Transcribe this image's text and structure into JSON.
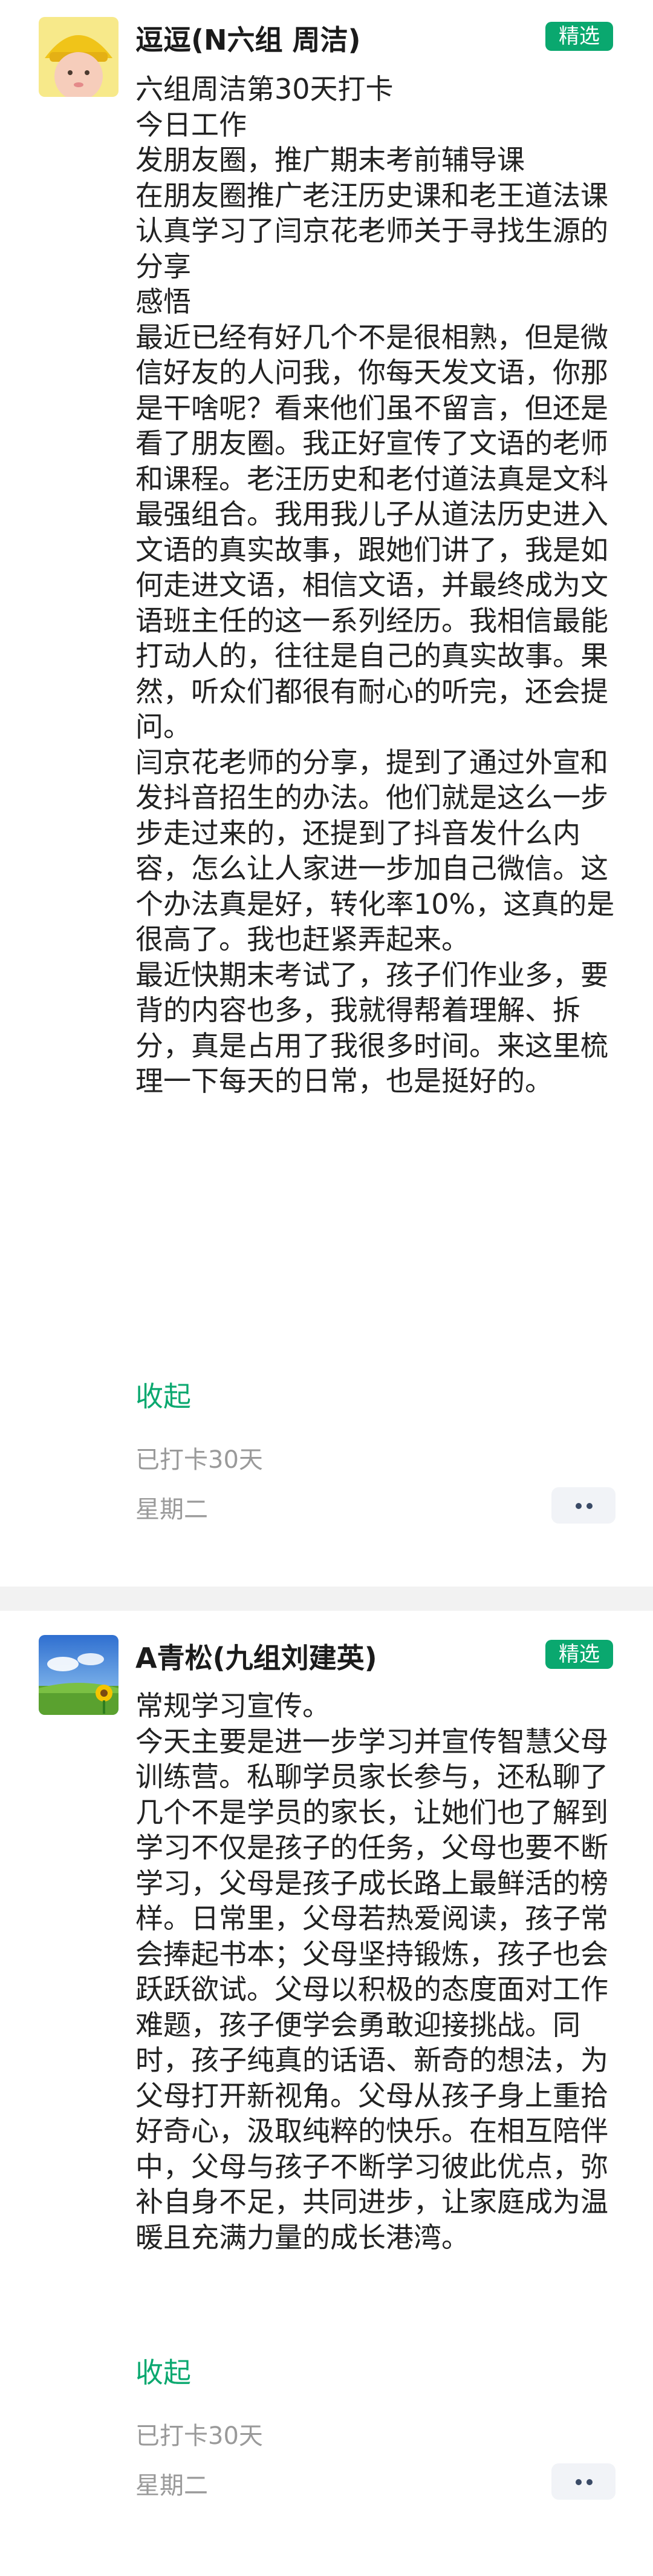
{
  "posts": [
    {
      "author": "逗逗(N六组 周洁)",
      "badge": "精选",
      "avatar_icon": "yellow-hat-child-avatar",
      "paragraphs": [
        "六组周洁第30天打卡",
        "今日工作",
        "发朋友圈，推广期末考前辅导课",
        "在朋友圈推广老汪历史课和老王道法课",
        "认真学习了闫京花老师关于寻找生源的分享",
        "感悟",
        "最近已经有好几个不是很相熟，但是微信好友的人问我，你每天发文语，你那是干啥呢？看来他们虽不留言，但还是看了朋友圈。我正好宣传了文语的老师和课程。老汪历史和老付道法真是文科最强组合。我用我儿子从道法历史进入文语的真实故事，跟她们讲了，我是如何走进文语，相信文语，并最终成为文语班主任的这一系列经历。我相信最能打动人的，往往是自己的真实故事。果然，听众们都很有耐心的听完，还会提问。",
        "闫京花老师的分享，提到了通过外宣和发抖音招生的办法。他们就是这么一步步走过来的，还提到了抖音发什么内容，怎么让人家进一步加自己微信。这个办法真是好，转化率10%，这真的是很高了。我也赶紧弄起来。",
        "最近快期末考试了，孩子们作业多，要背的内容也多，我就得帮着理解、拆分，真是占用了我很多时间。来这里梳理一下每天的日常，也是挺好的。"
      ],
      "collapse_label": "收起",
      "checkin_text": "已打卡30天",
      "date_text": "星期二"
    },
    {
      "author": "A青松(九组刘建英)",
      "badge": "精选",
      "avatar_icon": "sky-meadow-sunflower-avatar",
      "paragraphs": [
        "常规学习宣传。",
        "今天主要是进一步学习并宣传智慧父母训练营。私聊学员家长参与，还私聊了几个不是学员的家长，让她们也了解到学习不仅是孩子的任务，父母也要不断学习，父母是孩子成长路上最鲜活的榜样。日常里，父母若热爱阅读，孩子常会捧起书本；父母坚持锻炼，孩子也会跃跃欲试。父母以积极的态度面对工作难题，孩子便学会勇敢迎接挑战。同时，孩子纯真的话语、新奇的想法，为父母打开新视角。父母从孩子身上重拾好奇心，汲取纯粹的快乐。在相互陪伴中，父母与孩子不断学习彼此优点，弥补自身不足，共同进步，让家庭成为温暖且充满力量的成长港湾。"
      ],
      "collapse_label": "收起",
      "checkin_text": "已打卡30天",
      "date_text": "星期二"
    }
  ],
  "colors": {
    "accent_green": "#0aa86f",
    "muted_text": "#9a9a9a",
    "more_dots": "#3a4a66"
  }
}
